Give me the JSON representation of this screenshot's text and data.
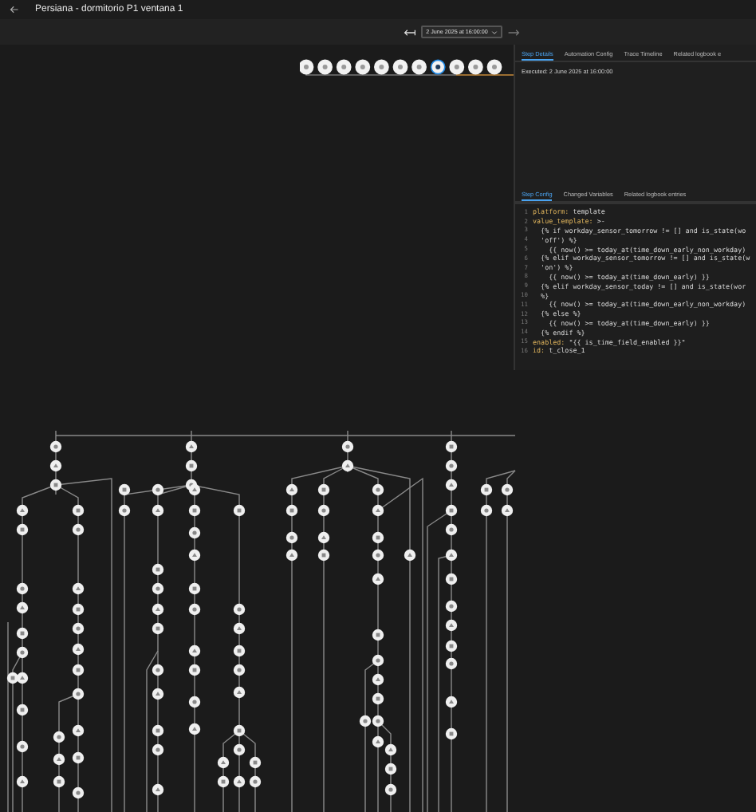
{
  "window": {
    "title": "Persiana - dormitorio P1 ventana 1"
  },
  "toolbar": {
    "run_select": "2 June 2025 at 16:00:00"
  },
  "trace_path": [
    {
      "selected": false
    },
    {
      "selected": false
    },
    {
      "selected": false
    },
    {
      "selected": false
    },
    {
      "selected": false
    },
    {
      "selected": false
    },
    {
      "selected": false
    },
    {
      "selected": true
    },
    {
      "selected": false
    },
    {
      "selected": false
    },
    {
      "selected": false
    }
  ],
  "panel": {
    "tabs": [
      {
        "label": "Step Details",
        "selected": true
      },
      {
        "label": "Automation Config",
        "selected": false
      },
      {
        "label": "Trace Timeline",
        "selected": false
      },
      {
        "label": "Related logbook e",
        "selected": false
      }
    ],
    "executed": "Executed: 2 June 2025 at 16:00:00",
    "sub_tabs": [
      {
        "label": "Step Config",
        "selected": true
      },
      {
        "label": "Changed Variables",
        "selected": false
      },
      {
        "label": "Related logbook entries",
        "selected": false
      }
    ],
    "code_lines": [
      {
        "number": "1",
        "key": "platform:",
        "text": " template"
      },
      {
        "number": "2",
        "key": "value_template:",
        "text": " >-"
      },
      {
        "number": "3",
        "text": "  {% if workday_sensor_tomorrow != [] and is_state(wo"
      },
      {
        "number": "4",
        "text": "  'off') %}"
      },
      {
        "number": "5",
        "text": "    {{ now() >= today_at(time_down_early_non_workday)"
      },
      {
        "number": "6",
        "text": "  {% elif workday_sensor_tomorrow != [] and is_state(w"
      },
      {
        "number": "7",
        "text": "  'on') %}"
      },
      {
        "number": "8",
        "text": "    {{ now() >= today_at(time_down_early) }}"
      },
      {
        "number": "9",
        "text": "  {% elif workday_sensor_today != [] and is_state(wor"
      },
      {
        "number": "10",
        "text": "  %}"
      },
      {
        "number": "11",
        "text": "    {{ now() >= today_at(time_down_early_non_workday)"
      },
      {
        "number": "12",
        "text": "  {% else %}"
      },
      {
        "number": "13",
        "text": "    {{ now() >= today_at(time_down_early) }}"
      },
      {
        "number": "14",
        "text": "  {% endif %}"
      },
      {
        "number": "15",
        "key": "enabled:",
        "text": " \"{{ is_time_field_enabled }}\""
      },
      {
        "number": "16",
        "key": "id:",
        "text": " t_close_1"
      }
    ]
  }
}
